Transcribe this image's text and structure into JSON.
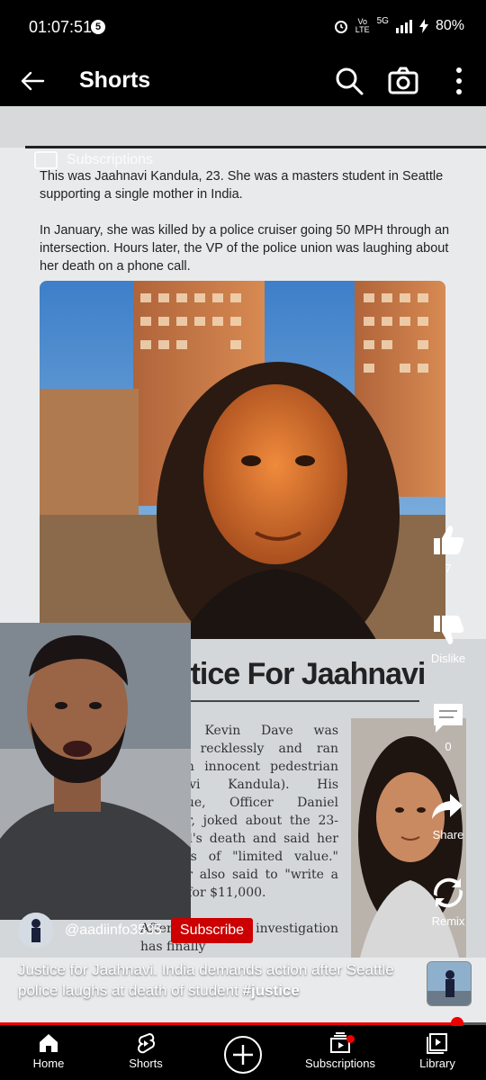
{
  "status": {
    "time": "01:07:51",
    "notification_count": "5",
    "network_top": "Vo",
    "network_bottom": "LTE",
    "signal": "5G",
    "battery": "80%"
  },
  "header": {
    "title": "Shorts"
  },
  "subscriptions_ghost": "Subscriptions",
  "article": {
    "para1": "This was Jaahnavi Kandula, 23. She was a masters student in Seattle supporting a single mother in India.",
    "para2": "In January, she was killed by a police cruiser going 50 MPH through an intersection. Hours later, the VP of the police union was laughing about her death on a phone call.",
    "headline": "Justice For Jaahnavi",
    "officer_text": "Officer Kevin Dave was driving recklessly and ran over an innocent pedestrian (Jaahnavi Kandula). His colleague, Officer Daniel Auderer, joked about the 23-year-old's death and said her life was of \"limited value.\" Auderer also said to \"write a check\" for $11,000.",
    "officer_text2": "After months, an investigation has finally"
  },
  "actions": {
    "like_count": "7",
    "dislike_label": "Dislike",
    "comment_count": "0",
    "share_label": "Share",
    "remix_label": "Remix"
  },
  "channel": {
    "handle": "@aadiinfo3535",
    "subscribe_label": "Subscribe"
  },
  "caption": {
    "text": "Justice for Jaahnavi. India demands action after Seattle police laughs at death of student ",
    "hashtag": "#justice"
  },
  "progress": 0.94,
  "nav": {
    "home": "Home",
    "shorts": "Shorts",
    "subscriptions": "Subscriptions",
    "library": "Library"
  },
  "colors": {
    "accent_red": "#cc0000",
    "progress_red": "#ee0000"
  }
}
